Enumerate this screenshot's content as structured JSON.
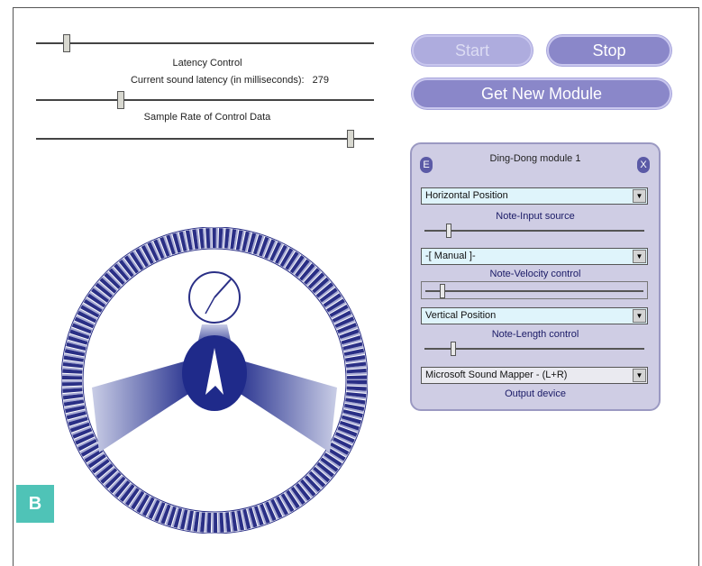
{
  "controls": {
    "top_slider_value_pct": 9,
    "latency_title": "Latency Control",
    "latency_label": "Current sound latency (in milliseconds):",
    "latency_value": "279",
    "latency_slider_value_pct": 25,
    "sample_rate_label": "Sample Rate of Control Data",
    "sample_rate_slider_value_pct": 93
  },
  "buttons": {
    "start": "Start",
    "stop": "Stop",
    "get_new_module": "Get New Module"
  },
  "module": {
    "title": "Ding-Dong module 1",
    "left_button_glyph": "E",
    "close_glyph": "X",
    "rows": [
      {
        "select_value": "Horizontal Position",
        "label": "Note-Input source",
        "slider_value_pct": 10
      },
      {
        "select_value": "-[ Manual ]-",
        "label": "Note-Velocity control",
        "slider_value_pct": 8
      },
      {
        "select_value": "Vertical Position",
        "label": "Note-Length control",
        "slider_value_pct": 12
      },
      {
        "select_value": "Microsoft Sound Mapper - (L+R)",
        "label": "Output device"
      }
    ]
  },
  "figure_label": "B",
  "colors": {
    "accent": "#8a87c9",
    "dial": "#2a2f86",
    "panel": "#cfcde4",
    "badge": "#4fc3b7"
  },
  "icons": [
    "dial-wheel-icon",
    "clock-icon",
    "chevron-down-icon",
    "close-icon"
  ]
}
